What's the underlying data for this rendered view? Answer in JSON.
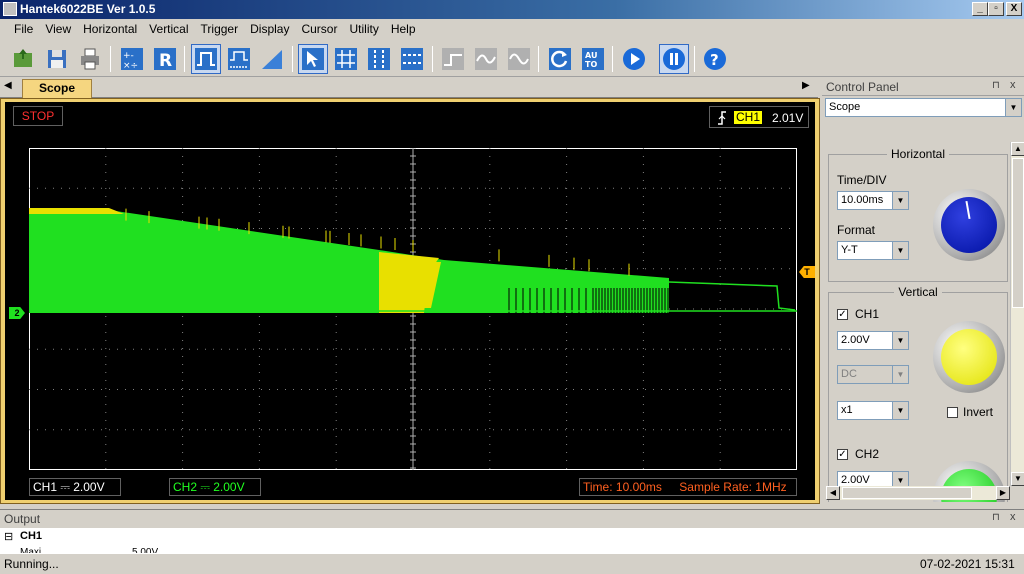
{
  "window": {
    "title": "Hantek6022BE Ver 1.0.5",
    "minimize": "_",
    "maximize": "▫",
    "close": "X"
  },
  "menu": [
    "File",
    "View",
    "Horizontal",
    "Vertical",
    "Trigger",
    "Display",
    "Cursor",
    "Utility",
    "Help"
  ],
  "toolbar": {
    "r_label": "R",
    "auto_label_top": "AU",
    "auto_label_bottom": "TO",
    "help_label": "?",
    "icons": [
      "open-icon",
      "save-icon",
      "print-icon",
      "math-icon",
      "reference-icon",
      "pulse-icon",
      "dual-pulse-icon",
      "ramp-icon",
      "cursor-select-icon",
      "grid-icon",
      "vertical-cursor-icon",
      "horizontal-cursor-icon",
      "step-icon",
      "sine-icon",
      "wave-icon",
      "rotate-icon",
      "auto-icon",
      "run-icon",
      "pause-icon",
      "help-icon"
    ]
  },
  "tabs": {
    "scope": "Scope",
    "left_arrow": "◀",
    "right_arrow": "▶"
  },
  "scope": {
    "run_state": "STOP",
    "trigger_source": "CH1",
    "trigger_level": "2.01V",
    "ch1_status": "CH1 ⎓ 2.00V",
    "ch2_status": "CH2 ⎓ 2.00V",
    "time_status": "Time: 10.00ms",
    "sample_rate": "Sample Rate: 1MHz",
    "ch2_marker": "2",
    "trigger_marker": "T",
    "colors": {
      "ch1": "#e8e000",
      "ch2": "#20e020",
      "trigger": "#ffb000",
      "stop": "#ff3030"
    }
  },
  "control_panel": {
    "title": "Control Panel",
    "pin": "⊓",
    "close": "x",
    "mode_select": "Scope",
    "horizontal": {
      "title": "Horizontal",
      "time_div_label": "Time/DIV",
      "time_div_value": "10.00ms",
      "format_label": "Format",
      "format_value": "Y-T"
    },
    "vertical": {
      "title": "Vertical",
      "ch1_label": "CH1",
      "ch1_checked": "✓",
      "ch1_volts": "2.00V",
      "ch1_coupling": "DC",
      "ch1_probe": "x1",
      "invert_label": "Invert",
      "ch2_label": "CH2",
      "ch2_checked": "✓",
      "ch2_volts": "2.00V"
    }
  },
  "output": {
    "title": "Output",
    "tree_toggle": "⊟",
    "tree_label": "CH1",
    "partial_row_left": "Maxi...",
    "partial_row_right": "5.00V",
    "pin": "⊓",
    "close": "x"
  },
  "statusbar": {
    "status": "Running...",
    "datetime": "07-02-2021  15:31"
  }
}
